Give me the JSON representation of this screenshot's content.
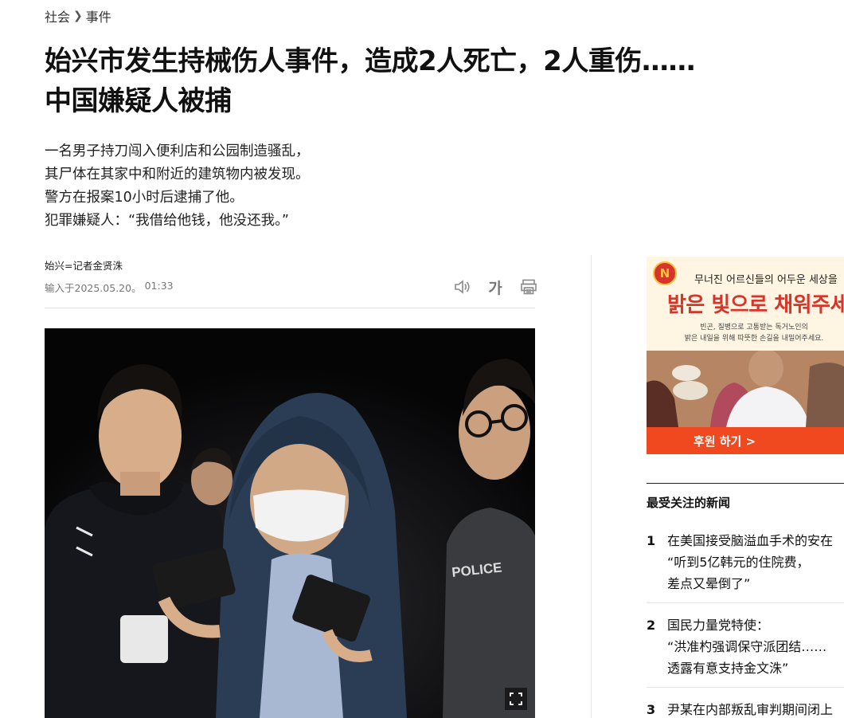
{
  "breadcrumb": {
    "section": "社会",
    "subsection": "事件"
  },
  "headline": [
    "始兴市发生持械伤人事件，造成2人死亡，2人重伤……",
    "中国嫌疑人被捕"
  ],
  "summary": [
    "一名男子持刀闯入便利店和公园制造骚乱，",
    "其尸体在其家中和附近的建筑物内被发现。",
    "警方在报案10小时后逮捕了他。",
    "犯罪嫌疑人：“我借给他钱，他没还我。”"
  ],
  "byline": "始兴=记者金贤洙",
  "published": {
    "label": "输入于2025.05.20。",
    "time": "01:33"
  },
  "tools": {
    "audio_icon": "speaker-icon",
    "font_label": "가",
    "print_icon": "print-icon"
  },
  "photo": {
    "police_text": "POLICE",
    "expand_icon": "expand-icon"
  },
  "ad": {
    "logo": "N",
    "tagline": "무너진 어르신들의 어두운 세상을",
    "headline": "밝은 빛으로 채워주세",
    "body": [
      "빈곤, 질병으로 고통받는 독거노인의",
      "밝은 내일을 위해 따뜻한 손길을 내밀어주세요."
    ],
    "cta": "후원 하기 >"
  },
  "popular": {
    "title": "最受关注的新闻",
    "items": [
      {
        "rank": "1",
        "lines": [
          "在美国接受脑溢血手术的安在",
          "“听到5亿韩元的住院费，",
          "差点又晕倒了”"
        ]
      },
      {
        "rank": "2",
        "lines": [
          "国民力量党特使：",
          "“洪准杓强调保守派团结……",
          "透露有意支持金文洙”"
        ]
      },
      {
        "rank": "3",
        "lines": [
          "尹某在内部叛乱审判期间闭上"
        ]
      }
    ]
  },
  "colors": {
    "ad_red": "#d8352a",
    "ad_cta": "#f0481f",
    "photo_bg": "#0b0b0d"
  }
}
